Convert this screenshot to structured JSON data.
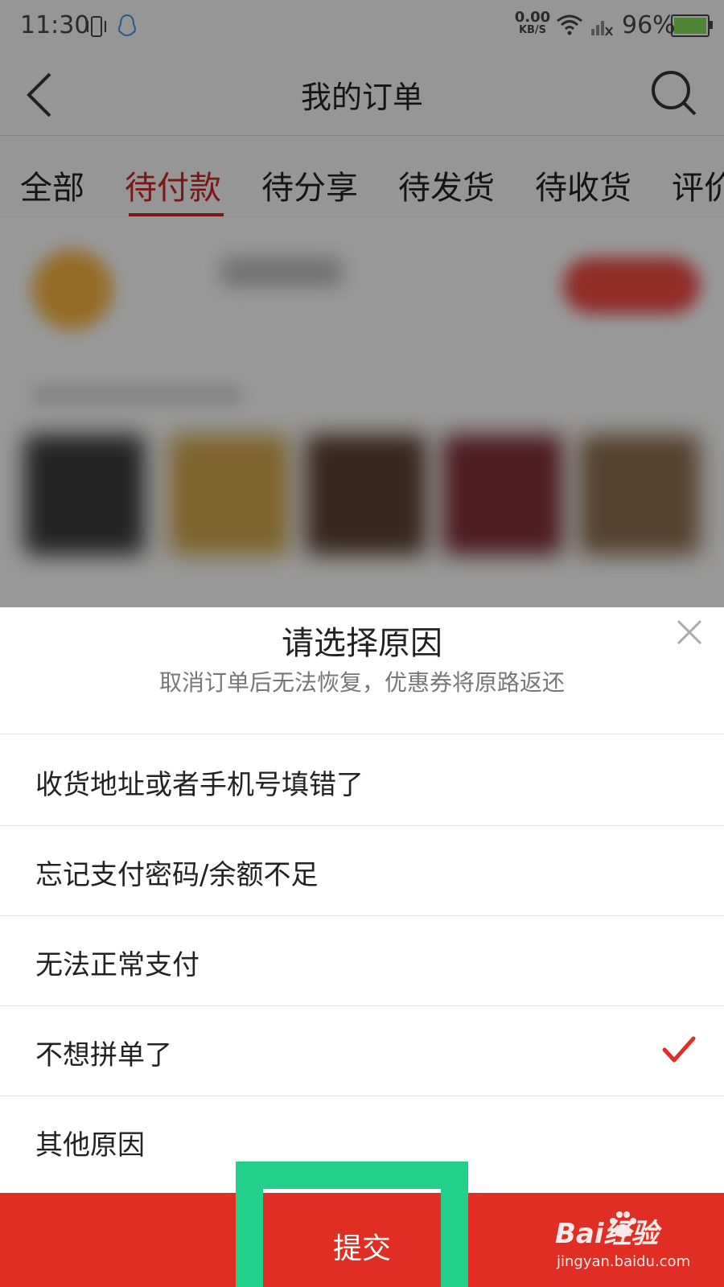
{
  "status_bar": {
    "time": "11:30",
    "net_speed_value": "0.00",
    "net_speed_unit": "KB/S",
    "battery_percent": "96%"
  },
  "nav": {
    "title": "我的订单"
  },
  "tabs": [
    {
      "label": "全部",
      "active": false
    },
    {
      "label": "待付款",
      "active": true
    },
    {
      "label": "待分享",
      "active": false
    },
    {
      "label": "待发货",
      "active": false
    },
    {
      "label": "待收货",
      "active": false
    },
    {
      "label": "评价",
      "active": false
    }
  ],
  "dialog": {
    "title": "请选择原因",
    "subtitle": "取消订单后无法恢复，优惠券将原路返还",
    "reasons": [
      {
        "label": "收货地址或者手机号填错了",
        "selected": false
      },
      {
        "label": "忘记支付密码/余额不足",
        "selected": false
      },
      {
        "label": "无法正常支付",
        "selected": false
      },
      {
        "label": "不想拼单了",
        "selected": true
      },
      {
        "label": "其他原因",
        "selected": false
      }
    ],
    "submit_label": "提交"
  },
  "watermark": {
    "brand": "Bai经验",
    "url": "jingyan.baidu.com"
  },
  "colors": {
    "accent": "#e02e24",
    "active_tab": "#c6251f",
    "highlight": "#22d08b"
  }
}
